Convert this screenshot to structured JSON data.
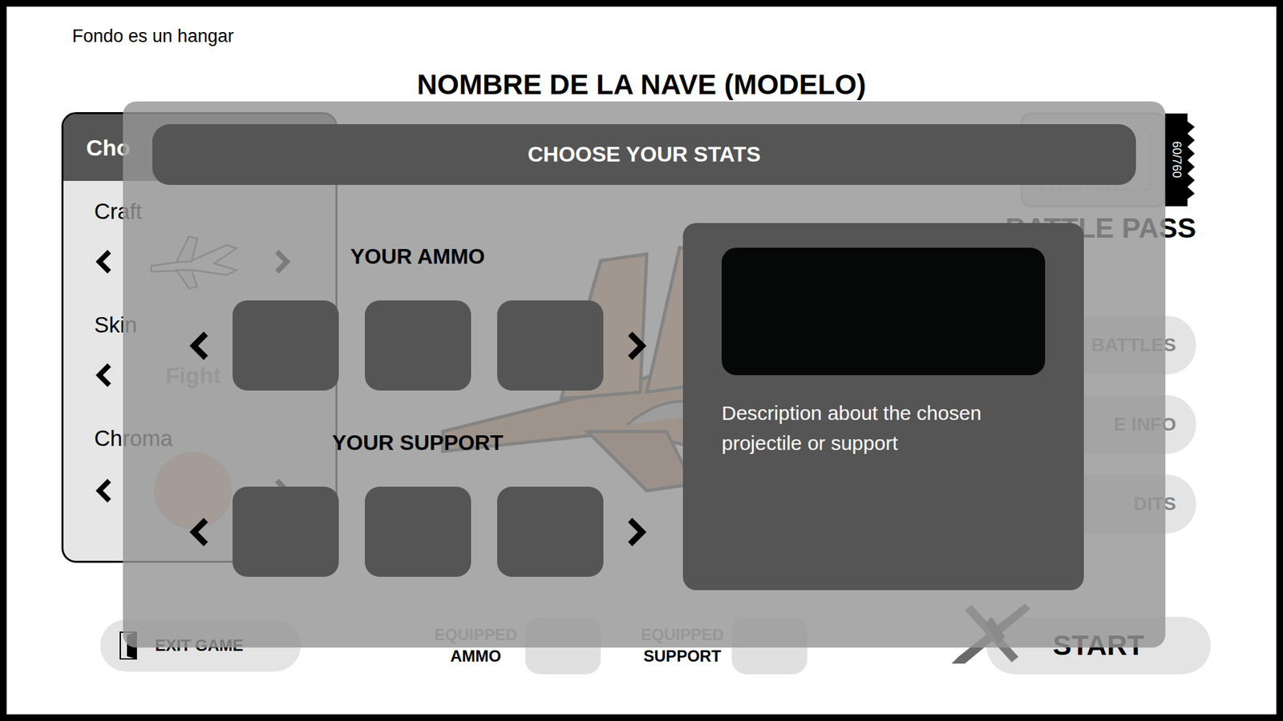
{
  "note": "Fondo es un hangar",
  "ship_title": "NOMBRE DE LA NAVE (MODELO)",
  "customize_panel": {
    "title": "Cho",
    "rows": [
      {
        "label": "Craft",
        "kind": "craft",
        "value": ""
      },
      {
        "label": "Skin",
        "kind": "text",
        "value": "Fight"
      },
      {
        "label": "Chroma",
        "kind": "color",
        "value": ""
      }
    ]
  },
  "battle_pass": {
    "progress": "60/760",
    "label": "BATTLE PASS"
  },
  "menu_buttons": [
    {
      "label": "BATTLES"
    },
    {
      "label": "E INFO"
    },
    {
      "label": "DITS"
    }
  ],
  "bottom_bar": {
    "exit": {
      "label": "EXIT GAME"
    },
    "equipped": [
      {
        "top": "EQUIPPED",
        "bottom": "AMMO",
        "empty": true
      },
      {
        "top": "EQUIPPED",
        "bottom": "SUPPORT",
        "empty": true
      }
    ],
    "start": {
      "label": "START"
    }
  },
  "modal": {
    "title": "CHOOSE YOUR STATS",
    "sections": [
      {
        "title": "YOUR AMMO",
        "slots": [
          {
            "empty": true
          },
          {
            "empty": true
          },
          {
            "empty": true
          }
        ]
      },
      {
        "title": "YOUR SUPPORT",
        "slots": [
          {
            "empty": true
          },
          {
            "empty": true
          },
          {
            "empty": true
          }
        ]
      }
    ],
    "details": {
      "preview_empty": true,
      "description": "Description about the chosen projectile or support"
    }
  }
}
